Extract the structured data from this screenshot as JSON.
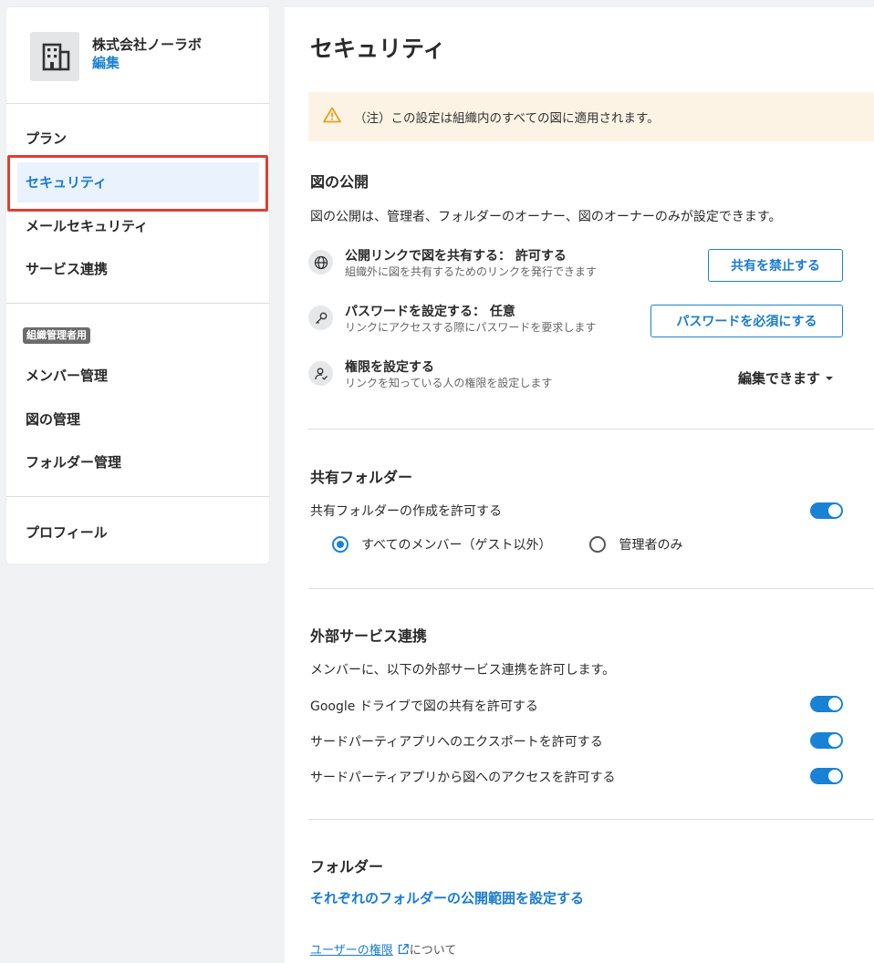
{
  "sidebar": {
    "org_name": "株式会社ノーラボ",
    "org_edit": "編集",
    "items": [
      {
        "label": "プラン"
      },
      {
        "label": "セキュリティ"
      },
      {
        "label": "メールセキュリティ"
      },
      {
        "label": "サービス連携"
      }
    ],
    "admin_badge": "組織管理者用",
    "admin_items": [
      {
        "label": "メンバー管理"
      },
      {
        "label": "図の管理"
      },
      {
        "label": "フォルダー管理"
      }
    ],
    "profile": "プロフィール"
  },
  "main": {
    "title": "セキュリティ",
    "notice": "（注）この設定は組織内のすべての図に適用されます。",
    "publish": {
      "title": "図の公開",
      "description": "図の公開は、管理者、フォルダーのオーナー、図のオーナーのみが設定できます。",
      "rows": [
        {
          "title": "公開リンクで図を共有する： 許可する",
          "sub": "組織外に図を共有するためのリンクを発行できます",
          "button": "共有を禁止する"
        },
        {
          "title": "パスワードを設定する： 任意",
          "sub": "リンクにアクセスする際にパスワードを要求します",
          "button": "パスワードを必須にする"
        },
        {
          "title": "権限を設定する",
          "sub": "リンクを知っている人の権限を設定します",
          "dropdown": "編集できます"
        }
      ]
    },
    "shared_folder": {
      "title": "共有フォルダー",
      "toggle_label": "共有フォルダーの作成を許可する",
      "options": [
        "すべてのメンバー（ゲスト以外）",
        "管理者のみ"
      ],
      "selected": "すべてのメンバー（ゲスト以外）"
    },
    "external": {
      "title": "外部サービス連携",
      "description": "メンバーに、以下の外部サービス連携を許可します。",
      "items": [
        {
          "label": "Google ドライブで図の共有を許可する",
          "enabled": true
        },
        {
          "label": "サードパーティアプリへのエクスポートを許可する",
          "enabled": true
        },
        {
          "label": "サードパーティアプリから図へのアクセスを許可する",
          "enabled": true
        }
      ]
    },
    "folder": {
      "title": "フォルダー",
      "link": "それぞれのフォルダーの公開範囲を設定する"
    },
    "footer": {
      "link": "ユーザーの権限",
      "suffix": "について"
    }
  },
  "colors": {
    "accent": "#1a82d4",
    "active_bg": "#e9f2fd",
    "highlight": "#e03e32",
    "notice_bg": "#fdf3e4",
    "warning": "#e6a020"
  },
  "icons": [
    "building-icon",
    "warning-icon",
    "globe-icon",
    "key-icon",
    "user-check-icon",
    "external-link-icon",
    "caret-down-icon"
  ]
}
